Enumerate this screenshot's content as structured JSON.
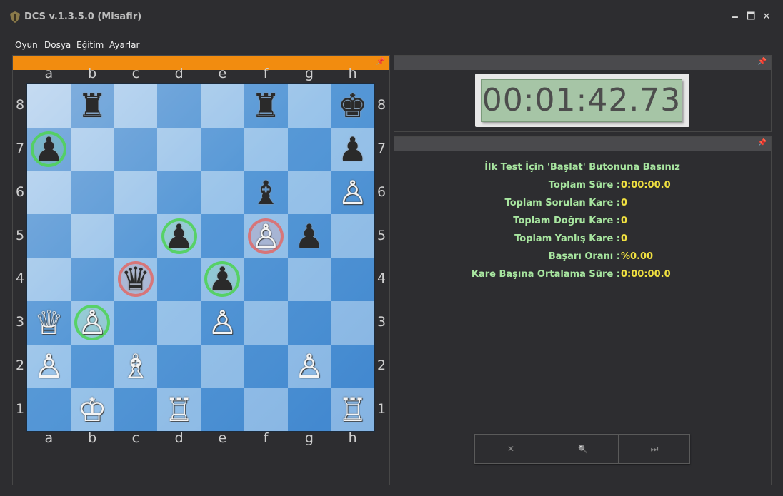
{
  "window": {
    "title": "DCS v.1.3.5.0 (Misafir)",
    "minimize": "🗕",
    "maximize": "🗖",
    "close": "✕"
  },
  "menu": [
    "Oyun",
    "Dosya",
    "Eğitim",
    "Ayarlar"
  ],
  "board": {
    "files": [
      "a",
      "b",
      "c",
      "d",
      "e",
      "f",
      "g",
      "h"
    ],
    "ranks": [
      "8",
      "7",
      "6",
      "5",
      "4",
      "3",
      "2",
      "1"
    ],
    "pieces": [
      {
        "sq": "b8",
        "color": "black",
        "type": "rook"
      },
      {
        "sq": "f8",
        "color": "black",
        "type": "rook"
      },
      {
        "sq": "h8",
        "color": "black",
        "type": "king"
      },
      {
        "sq": "a7",
        "color": "black",
        "type": "pawn"
      },
      {
        "sq": "h7",
        "color": "black",
        "type": "pawn"
      },
      {
        "sq": "f6",
        "color": "black",
        "type": "bishop"
      },
      {
        "sq": "h6",
        "color": "white",
        "type": "pawn"
      },
      {
        "sq": "d5",
        "color": "black",
        "type": "pawn"
      },
      {
        "sq": "f5",
        "color": "white",
        "type": "pawn"
      },
      {
        "sq": "g5",
        "color": "black",
        "type": "pawn"
      },
      {
        "sq": "c4",
        "color": "black",
        "type": "queen"
      },
      {
        "sq": "e4",
        "color": "black",
        "type": "pawn"
      },
      {
        "sq": "a3",
        "color": "white",
        "type": "queen"
      },
      {
        "sq": "b3",
        "color": "white",
        "type": "pawn"
      },
      {
        "sq": "e3",
        "color": "white",
        "type": "pawn"
      },
      {
        "sq": "a2",
        "color": "white",
        "type": "pawn"
      },
      {
        "sq": "c2",
        "color": "white",
        "type": "bishop"
      },
      {
        "sq": "g2",
        "color": "white",
        "type": "pawn"
      },
      {
        "sq": "b1",
        "color": "white",
        "type": "king"
      },
      {
        "sq": "d1",
        "color": "white",
        "type": "rook"
      },
      {
        "sq": "h1",
        "color": "white",
        "type": "rook"
      }
    ],
    "highlights": [
      {
        "sq": "a7",
        "color": "green"
      },
      {
        "sq": "d5",
        "color": "green"
      },
      {
        "sq": "f5",
        "color": "red"
      },
      {
        "sq": "c4",
        "color": "red"
      },
      {
        "sq": "e4",
        "color": "green"
      },
      {
        "sq": "b3",
        "color": "green"
      }
    ]
  },
  "timer": {
    "value": "00:01:42.73"
  },
  "stats": {
    "heading": "İlk Test İçin 'Başlat' Butonuna Basınız",
    "rows": [
      {
        "label": "Toplam Süre :",
        "value": "0:00:00.0"
      },
      {
        "label": "Toplam Sorulan Kare :",
        "value": "0"
      },
      {
        "label": "Toplam Doğru Kare :",
        "value": "0"
      },
      {
        "label": "Toplam Yanlış Kare :",
        "value": "0"
      },
      {
        "label": "Başarı Oranı :",
        "value": "%0.00"
      },
      {
        "label": "Kare Başına Ortalama Süre :",
        "value": "0:00:00.0"
      }
    ]
  },
  "buttons": [
    {
      "icon": "close-icon",
      "glyph": "✕"
    },
    {
      "icon": "search-icon",
      "glyph": "🔍"
    },
    {
      "icon": "fast-forward-icon",
      "glyph": "⏭"
    }
  ],
  "colors": {
    "accent": "#f28c0f",
    "label": "#a8e6a0",
    "value": "#f0e040"
  }
}
